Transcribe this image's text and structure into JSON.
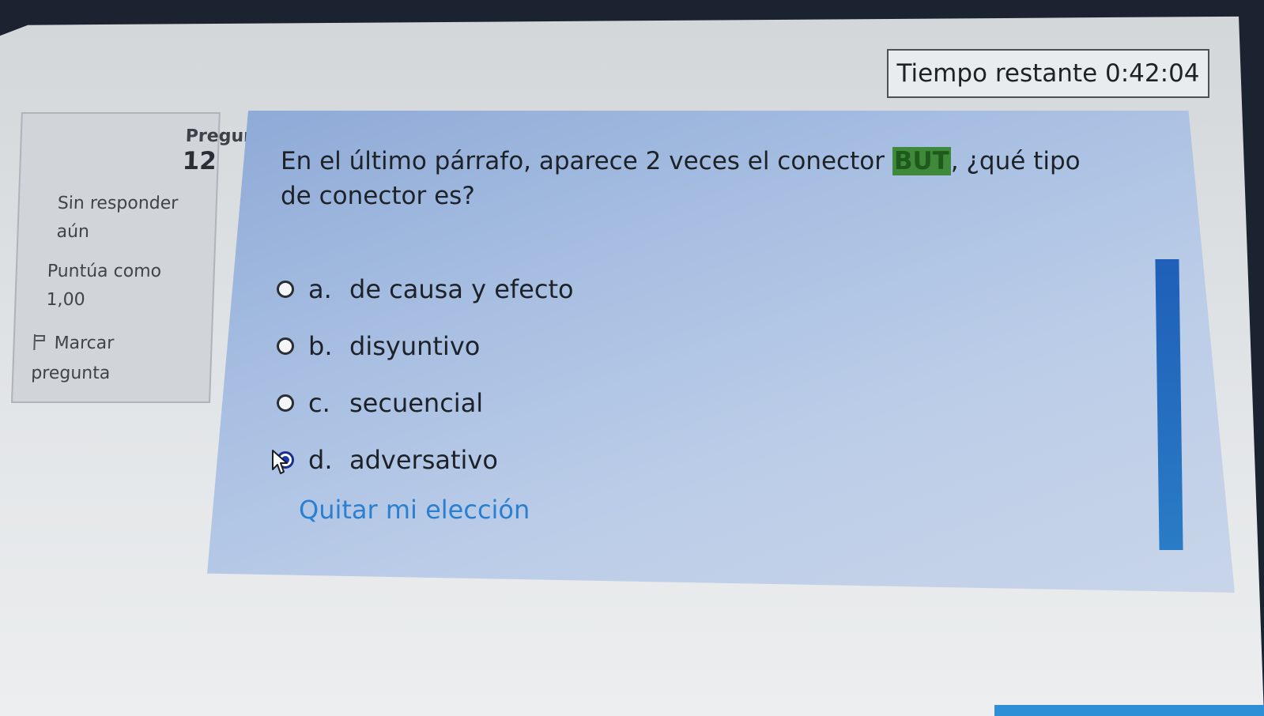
{
  "timer": {
    "label": "Tiempo restante",
    "value": "0:42:04"
  },
  "info": {
    "question_label": "Pregun",
    "question_number": "12",
    "status": "Sin responder aún",
    "points": "Puntúa como 1,00",
    "flag_label": "Marcar pregunta",
    "flag_icon": "flag-icon"
  },
  "question": {
    "text_before": "En el último párrafo, aparece 2 veces el conector ",
    "highlight": "BUT",
    "text_after": ", ¿qué tipo de conector es?",
    "highlight_color": "#3e8a3a"
  },
  "answers": [
    {
      "letter": "a.",
      "text": "de causa y efecto",
      "selected": false
    },
    {
      "letter": "b.",
      "text": "disyuntivo",
      "selected": false
    },
    {
      "letter": "c.",
      "text": "secuencial",
      "selected": false
    },
    {
      "letter": "d.",
      "text": "adversativo",
      "selected": true
    }
  ],
  "clear_choice": "Quitar mi elección",
  "colors": {
    "link": "#2a7fd0",
    "scroll_accent": "#1f5fb8",
    "selected_radio": "#1638b8"
  }
}
